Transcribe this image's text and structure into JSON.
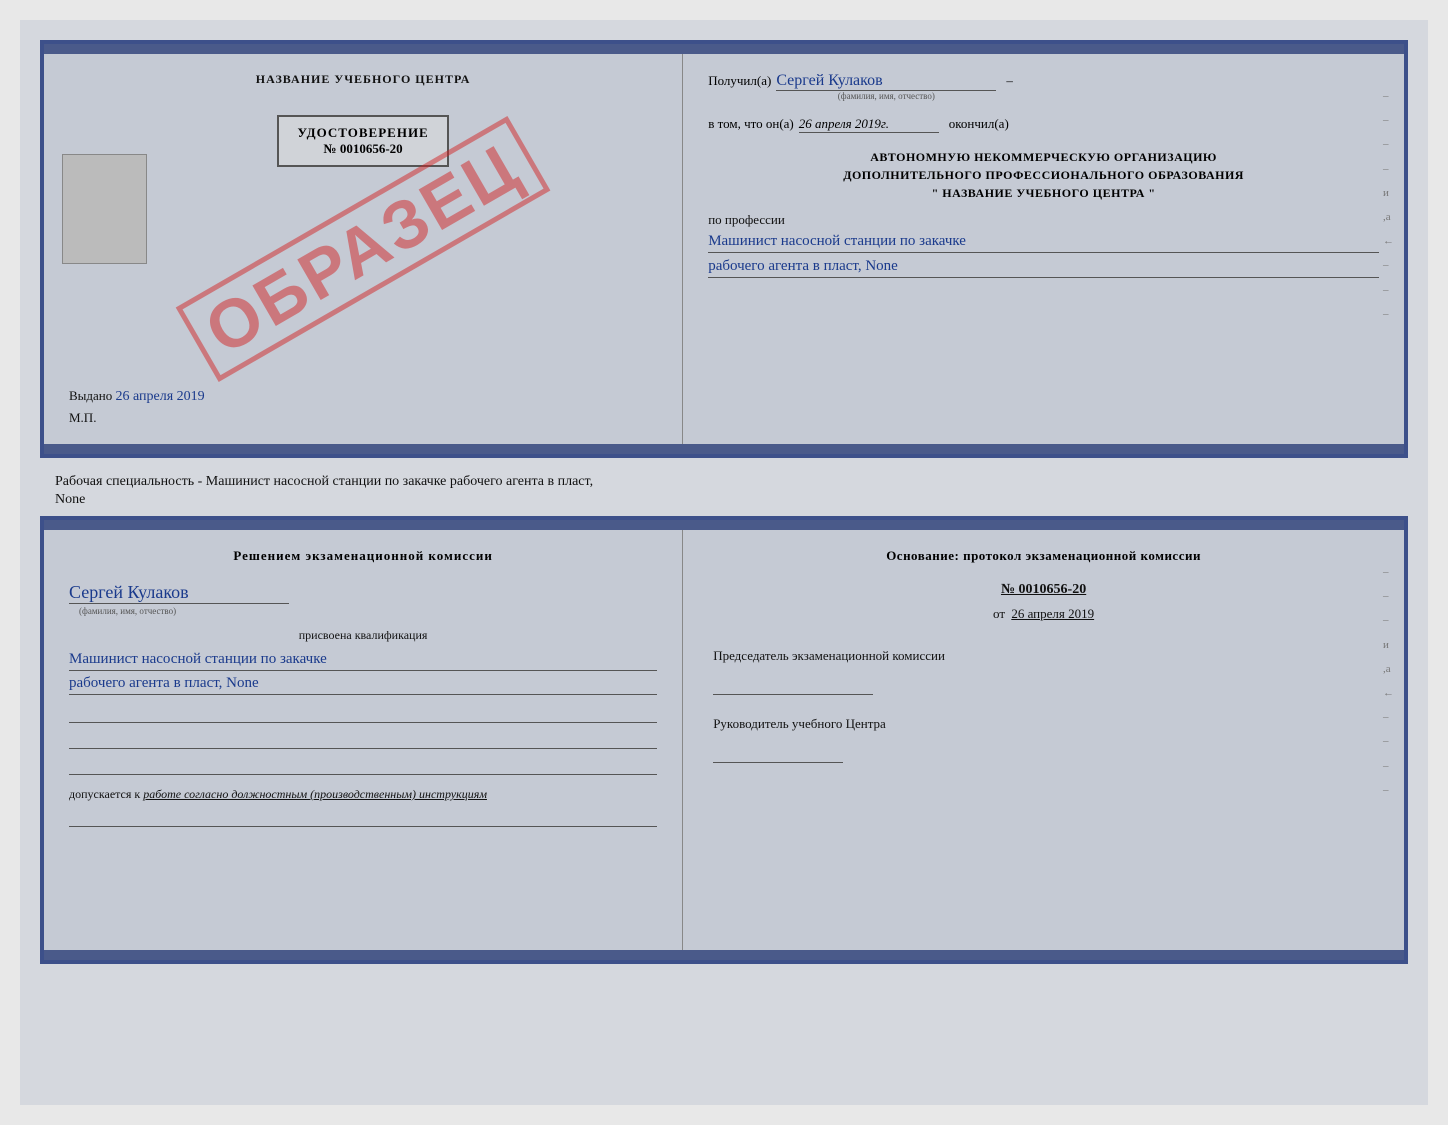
{
  "page": {
    "background_color": "#e0e3e8"
  },
  "top_document": {
    "left": {
      "center_title": "НАЗВАНИЕ УЧЕБНОГО ЦЕНТРА",
      "udostoverenie": {
        "title": "УДОСТОВЕРЕНИЕ",
        "number": "№ 0010656-20"
      },
      "vibano_label": "Выдано",
      "vibano_date": "26 апреля 2019",
      "mp_label": "М.П."
    },
    "right": {
      "poluchil_label": "Получил(а)",
      "poluchil_value": "Сергей Кулаков",
      "poluchil_hint": "(фамилия, имя, отчество)",
      "v_tom_label": "в том, что он(а)",
      "v_tom_date": "26 апреля 2019г.",
      "okonchill_label": "окончил(а)",
      "org_line1": "АВТОНОМНУЮ НЕКОММЕРЧЕСКУЮ ОРГАНИЗАЦИЮ",
      "org_line2": "ДОПОЛНИТЕЛЬНОГО ПРОФЕССИОНАЛЬНОГО ОБРАЗОВАНИЯ",
      "org_line3": "\"  НАЗВАНИЕ УЧЕБНОГО ЦЕНТРА  \"",
      "po_professii_label": "по профессии",
      "profession_line1": "Машинист насосной станции по закачке",
      "profession_line2": "рабочего агента в пласт, None"
    },
    "watermark": "ОБРАЗЕЦ"
  },
  "separator": {
    "text1": "Рабочая специальность - Машинист насосной станции по закачке рабочего агента в пласт,",
    "text2": "None"
  },
  "bottom_document": {
    "left": {
      "resheniyem_title": "Решением экзаменационной комиссии",
      "name_value": "Сергей Кулаков",
      "name_hint": "(фамилия, имя, отчество)",
      "prisvoyena_text": "присвоена квалификация",
      "qualification_line1": "Машинист насосной станции по закачке",
      "qualification_line2": "рабочего агента в пласт, None",
      "dopuskaetsya_label": "допускается к",
      "dopuskaetsya_value": "работе согласно должностным (производственным) инструкциям"
    },
    "right": {
      "osnovanie_title": "Основание: протокол экзаменационной комиссии",
      "protocol_number": "№ 0010656-20",
      "ot_label": "от",
      "ot_date": "26 апреля 2019",
      "predsedatel_label": "Председатель экзаменационной комиссии",
      "rukovoditel_label": "Руководитель учебного Центра"
    }
  }
}
